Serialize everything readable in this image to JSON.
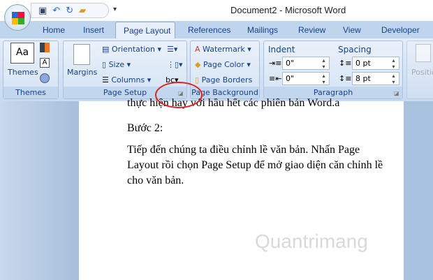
{
  "window": {
    "title": "Document2 - Microsoft Word"
  },
  "qat": {
    "icons": [
      "save-icon",
      "undo-icon",
      "redo-icon",
      "open-icon"
    ],
    "customize": "▾"
  },
  "tabs": [
    "Home",
    "Insert",
    "Page Layout",
    "References",
    "Mailings",
    "Review",
    "View",
    "Developer"
  ],
  "active_tab": "Page Layout",
  "ribbon": {
    "themes": {
      "label": "Themes",
      "button": "Themes"
    },
    "page_setup": {
      "label": "Page Setup",
      "margins": "Margins",
      "orientation": "Orientation",
      "size": "Size",
      "columns": "Columns"
    },
    "page_background": {
      "label": "Page Background",
      "watermark": "Watermark",
      "page_color": "Page Color",
      "page_borders": "Page Borders"
    },
    "paragraph": {
      "label": "Paragraph",
      "indent": "Indent",
      "spacing": "Spacing",
      "indent_left": "0\"",
      "indent_right": "0\"",
      "spacing_before": "0 pt",
      "spacing_after": "8 pt"
    },
    "arrange": {
      "position": "Positio"
    }
  },
  "document": {
    "lines": [
      "thực hiện hay với hầu hết các phiên bản Word.a",
      "Bước 2:",
      "Tiếp đến chúng ta điều chỉnh lề văn bản. Nhấn Page",
      "Layout rồi chọn Page Setup để mở giao diện căn chỉnh lề",
      "cho văn bản."
    ]
  },
  "watermark": "Quantrimang",
  "colors": {
    "annotation": "#e02020",
    "tab_bar": "#bfd5ee"
  }
}
